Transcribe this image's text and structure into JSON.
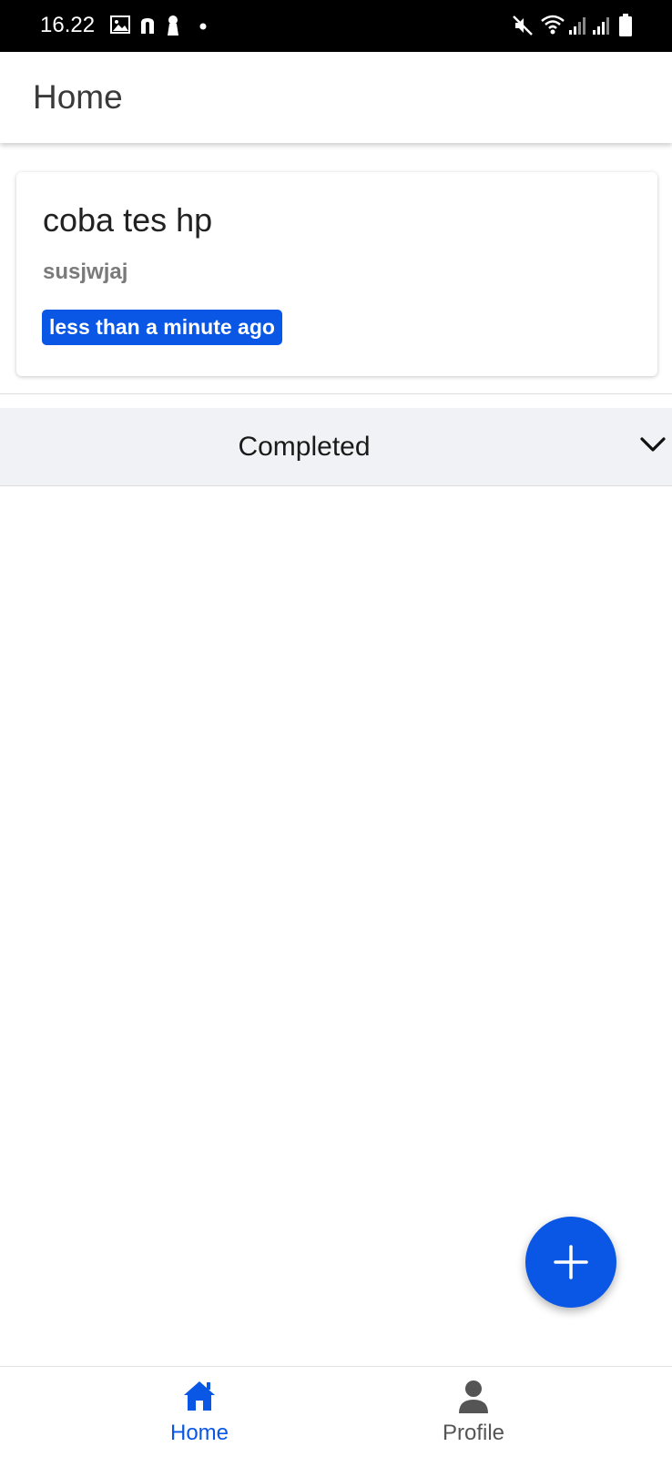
{
  "status_bar": {
    "time": "16.22",
    "left_icons": [
      "gallery-icon",
      "n-app-icon",
      "keyhole-icon",
      "notification-dot-icon"
    ],
    "right_icons": [
      "mute-icon",
      "wifi-icon",
      "signal-icon",
      "signal-icon",
      "battery-icon"
    ]
  },
  "app_bar": {
    "title": "Home"
  },
  "tasks": [
    {
      "title": "coba tes hp",
      "description": "susjwjaj",
      "time_badge": "less than a minute ago"
    }
  ],
  "completed_section": {
    "label": "Completed",
    "expanded": false,
    "icon": "chevron-down-icon"
  },
  "fab": {
    "icon": "plus-icon"
  },
  "bottom_nav": {
    "items": [
      {
        "label": "Home",
        "icon": "home-icon",
        "active": true
      },
      {
        "label": "Profile",
        "icon": "person-icon",
        "active": false
      }
    ]
  },
  "colors": {
    "accent": "#0a57e6",
    "status_bar": "#000000",
    "completed_header_bg": "#f1f2f5",
    "inactive_nav": "#555555"
  }
}
